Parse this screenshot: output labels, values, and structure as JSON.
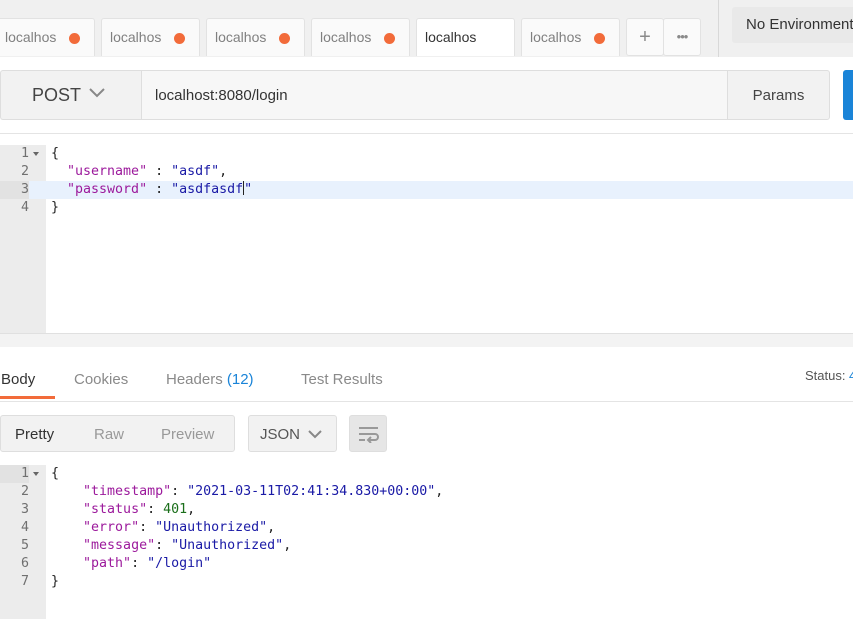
{
  "tabs": {
    "items": [
      {
        "label": "localhos",
        "active": false
      },
      {
        "label": "localhos",
        "active": false
      },
      {
        "label": "localhos",
        "active": false
      },
      {
        "label": "localhos",
        "active": false
      },
      {
        "label": "localhos",
        "active": true
      },
      {
        "label": "localhos",
        "active": false
      }
    ],
    "new_tab": "+",
    "more": "•••",
    "unsaved_color": "#f26b3a"
  },
  "environment": {
    "label": "No Environment"
  },
  "request": {
    "method": "POST",
    "url": "localhost:8080/login",
    "params_label": "Params",
    "send_color": "#1a84d8"
  },
  "request_body": {
    "lines": [
      {
        "n": "1",
        "text": "{"
      },
      {
        "n": "2",
        "text": "  \"username\" : \"asdf\","
      },
      {
        "n": "3",
        "text": "  \"password\" : \"asdfasdf\""
      },
      {
        "n": "4",
        "text": "}"
      }
    ]
  },
  "response_tabs": {
    "body": "Body",
    "cookies": "Cookies",
    "headers": "Headers",
    "headers_count": "(12)",
    "tests": "Test Results",
    "status_label": "Status:",
    "status_value": "4",
    "accent": "#f26b3a"
  },
  "response_toolbar": {
    "views": [
      "Pretty",
      "Raw",
      "Preview"
    ],
    "format": "JSON"
  },
  "response_body": {
    "lines": [
      {
        "n": "1",
        "text": "{"
      },
      {
        "n": "2",
        "text": "    \"timestamp\": \"2021-03-11T02:41:34.830+00:00\","
      },
      {
        "n": "3",
        "text": "    \"status\": 401,"
      },
      {
        "n": "4",
        "text": "    \"error\": \"Unauthorized\","
      },
      {
        "n": "5",
        "text": "    \"message\": \"Unauthorized\","
      },
      {
        "n": "6",
        "text": "    \"path\": \"/login\""
      },
      {
        "n": "7",
        "text": "}"
      }
    ]
  }
}
